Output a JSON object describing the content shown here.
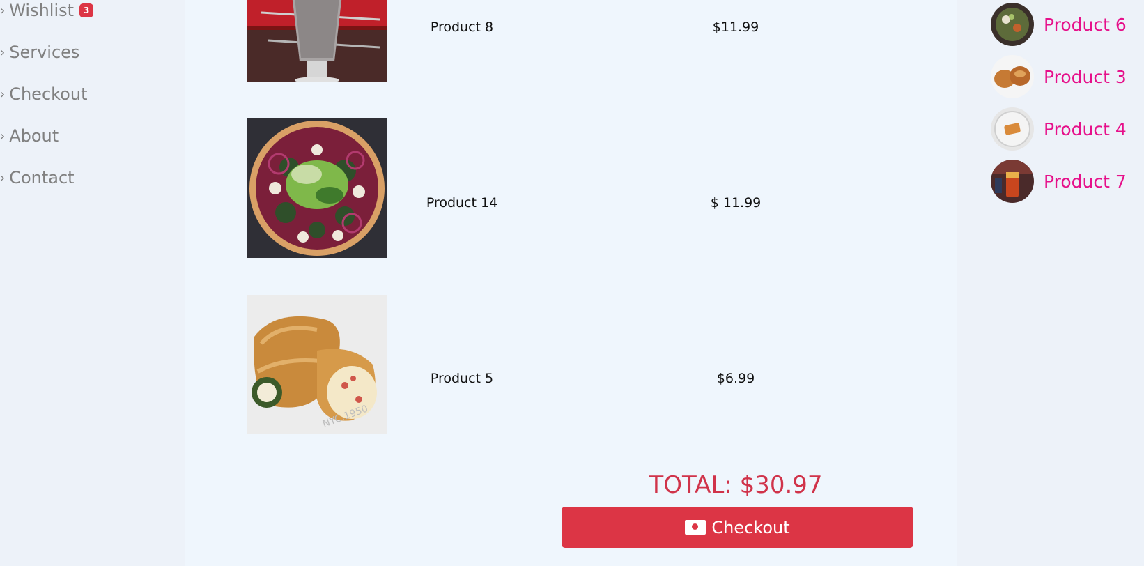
{
  "sidebar": {
    "items": [
      {
        "label": "Wishlist",
        "badge": "3"
      },
      {
        "label": "Services"
      },
      {
        "label": "Checkout"
      },
      {
        "label": "About"
      },
      {
        "label": "Contact"
      }
    ],
    "chevron": "›"
  },
  "cart": {
    "rows": [
      {
        "name": "Product 8",
        "price": "$11.99",
        "image": "milkshake-image"
      },
      {
        "name": "Product 14",
        "price": "$ 11.99",
        "image": "pizza-image"
      },
      {
        "name": "Product 5",
        "price": "$6.99",
        "image": "stromboli-image"
      }
    ],
    "total": "TOTAL: $30.97",
    "checkout_label": "Checkout",
    "checkout_icon": "cash-icon"
  },
  "recently_viewed": {
    "items": [
      {
        "label": "Product 6",
        "image": "salad-bowl-thumb"
      },
      {
        "label": "Product 3",
        "image": "pastry-thumb"
      },
      {
        "label": "Product 4",
        "image": "pastry-plate-thumb"
      },
      {
        "label": "Product 7",
        "image": "drink-thumb"
      }
    ]
  },
  "colors": {
    "accent": "#dc3545",
    "link": "#e6108a",
    "main_bg": "#eff6fd",
    "side_bg": "#edf2f9"
  }
}
